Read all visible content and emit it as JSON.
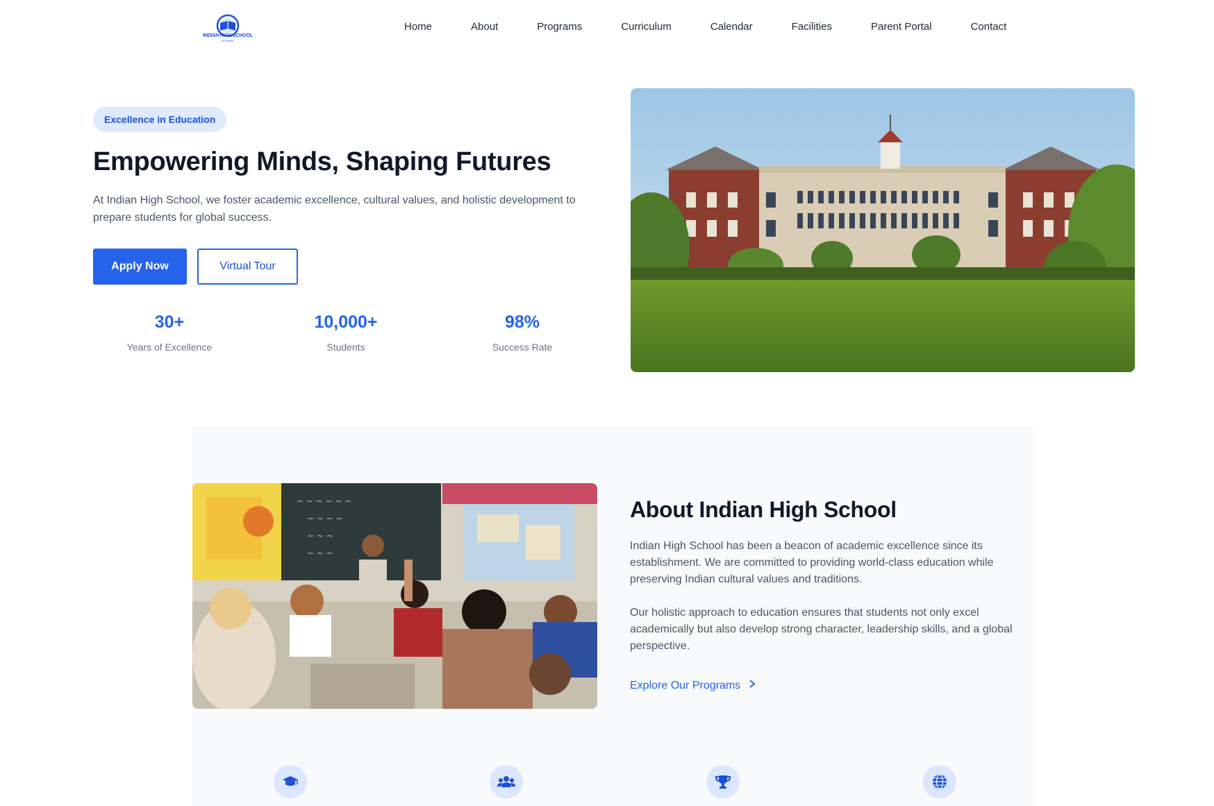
{
  "logo": {
    "text": "INDIAN HIGH SCHOOL",
    "subtext": "GUJARAT"
  },
  "nav": {
    "items": [
      {
        "label": "Home"
      },
      {
        "label": "About"
      },
      {
        "label": "Programs"
      },
      {
        "label": "Curriculum"
      },
      {
        "label": "Calendar"
      },
      {
        "label": "Facilities"
      },
      {
        "label": "Parent Portal"
      },
      {
        "label": "Contact"
      }
    ]
  },
  "hero": {
    "badge": "Excellence in Education",
    "title": "Empowering Minds, Shaping Futures",
    "description": "At Indian High School, we foster academic excellence, cultural values, and holistic development to prepare students for global success.",
    "primary_button": "Apply Now",
    "secondary_button": "Virtual Tour",
    "stats": [
      {
        "value": "30+",
        "label": "Years of Excellence"
      },
      {
        "value": "10,000+",
        "label": "Students"
      },
      {
        "value": "98%",
        "label": "Success Rate"
      }
    ],
    "image": "school-building-photo"
  },
  "about": {
    "title": "About Indian High School",
    "paragraph1": "Indian High School has been a beacon of academic excellence since its establishment. We are committed to providing world-class education while preserving Indian cultural values and traditions.",
    "paragraph2": "Our holistic approach to education ensures that students not only excel academically but also develop strong character, leadership skills, and a global perspective.",
    "link": "Explore Our Programs",
    "image": "classroom-photo",
    "feature_icons": [
      "graduation-cap-icon",
      "users-icon",
      "trophy-icon",
      "globe-icon"
    ]
  },
  "colors": {
    "accent": "#2563eb",
    "badge_bg": "#e0eaff",
    "section_bg": "#f8fafc",
    "heading": "#111827",
    "body_text": "#4b5563"
  }
}
